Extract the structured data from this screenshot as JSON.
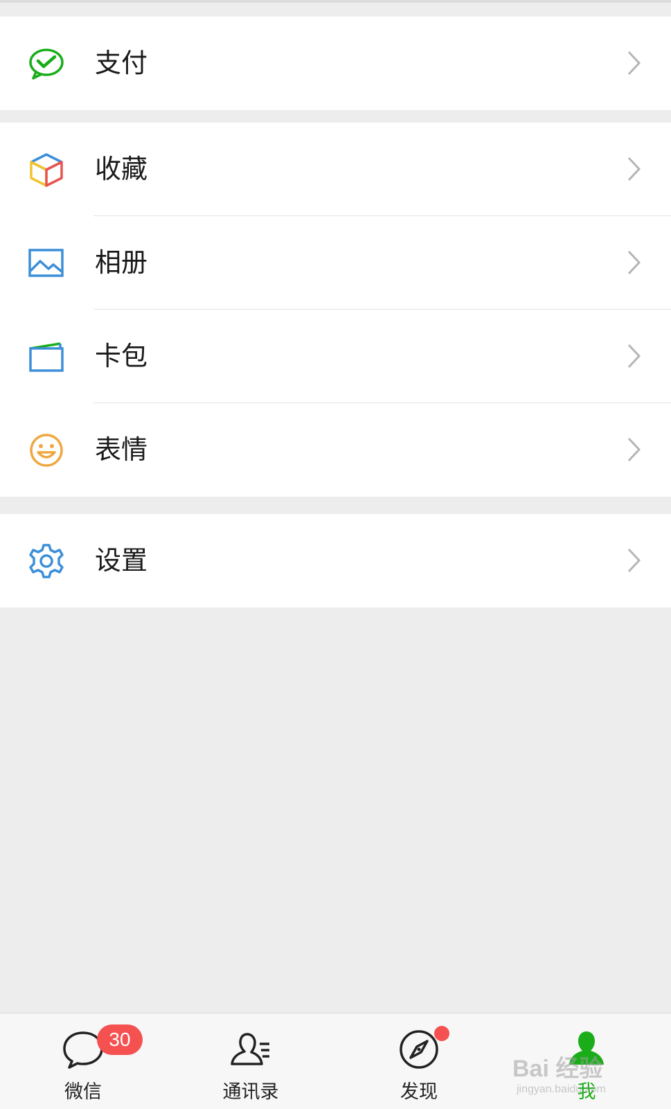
{
  "menu": {
    "pay": {
      "label": "支付",
      "icon": "wechat-pay-icon"
    },
    "favorites": {
      "label": "收藏",
      "icon": "favorites-cube-icon"
    },
    "album": {
      "label": "相册",
      "icon": "photo-album-icon"
    },
    "cards": {
      "label": "卡包",
      "icon": "card-wallet-icon"
    },
    "stickers": {
      "label": "表情",
      "icon": "smiley-face-icon"
    },
    "settings": {
      "label": "设置",
      "icon": "gear-icon"
    }
  },
  "tabbar": {
    "chats": {
      "label": "微信",
      "badge": "30",
      "icon": "chat-bubble-icon"
    },
    "contacts": {
      "label": "通讯录",
      "icon": "contacts-icon"
    },
    "discover": {
      "label": "发现",
      "icon": "compass-icon",
      "has_dot": true
    },
    "me": {
      "label": "我",
      "icon": "person-icon",
      "active": true
    }
  },
  "watermark": {
    "main": "Bai 经验",
    "sub": "jingyan.baidu.com"
  },
  "colors": {
    "accent": "#1aad19",
    "badge": "#f55151",
    "background": "#ededed"
  }
}
